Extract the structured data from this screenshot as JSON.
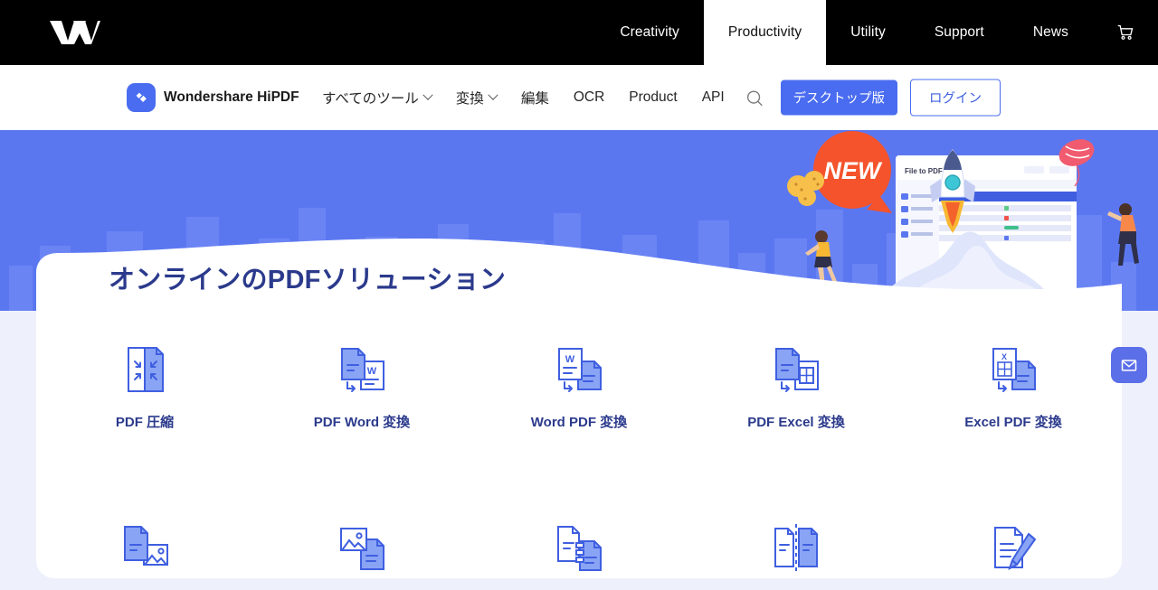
{
  "topbar": {
    "logo_icon": "wondershare-logo-icon",
    "nav": [
      {
        "label": "Creativity",
        "active": false
      },
      {
        "label": "Productivity",
        "active": true
      },
      {
        "label": "Utility",
        "active": false
      },
      {
        "label": "Support",
        "active": false
      },
      {
        "label": "News",
        "active": false
      }
    ],
    "cart_icon": "shopping-cart-icon",
    "bg_color": "#000000",
    "active_bg_color": "#ffffff"
  },
  "subnav": {
    "brand_name": "Wondershare HiPDF",
    "brand_icon": "hipdf-diamond-logo-icon",
    "links": [
      {
        "label": "すべてのツール",
        "has_caret": true
      },
      {
        "label": "変換",
        "has_caret": true
      },
      {
        "label": "編集",
        "has_caret": false
      },
      {
        "label": "OCR",
        "has_caret": false
      },
      {
        "label": "Product",
        "has_caret": false
      },
      {
        "label": "API",
        "has_caret": false
      }
    ],
    "search_icon": "search-icon",
    "desktop_button": "デスクトップ版",
    "login_button": "ログイン",
    "accent_color": "#4a6cf0"
  },
  "hero": {
    "title": "オンラインのPDFソリューション",
    "bg_color": "#5b77f0",
    "title_color": "#2b3a8c",
    "badge_text": "NEW",
    "badge_color": "#f4532b",
    "app_window_title": "File to PDF",
    "illustration": "rocket-launch-pdf-app-illustration"
  },
  "tools": [
    {
      "label": "PDF 圧縮",
      "icon": "compress-pdf-icon"
    },
    {
      "label": "PDF Word 変換",
      "icon": "pdf-to-word-icon"
    },
    {
      "label": "Word PDF 変換",
      "icon": "word-to-pdf-icon"
    },
    {
      "label": "PDF Excel 変換",
      "icon": "pdf-to-excel-icon"
    },
    {
      "label": "Excel PDF 変換",
      "icon": "excel-to-pdf-icon"
    },
    {
      "label": "",
      "icon": "pdf-to-image-icon"
    },
    {
      "label": "",
      "icon": "image-to-pdf-icon"
    },
    {
      "label": "",
      "icon": "merge-pdf-icon"
    },
    {
      "label": "",
      "icon": "split-pdf-icon"
    },
    {
      "label": "",
      "icon": "edit-pdf-icon"
    }
  ],
  "floating": {
    "mail_icon": "envelope-icon",
    "mail_color": "#5b6fe8"
  }
}
